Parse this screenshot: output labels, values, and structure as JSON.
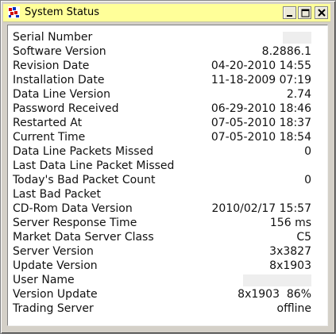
{
  "window": {
    "title": "System Status",
    "minimize_label": "_",
    "maximize_label": "□",
    "close_label": "X"
  },
  "rows": [
    {
      "label": "Serial Number",
      "value": ""
    },
    {
      "label": "Software Version",
      "value": "8.2886.1"
    },
    {
      "label": "Revision Date",
      "value": "04-20-2010 14:55"
    },
    {
      "label": "Installation Date",
      "value": "11-18-2009 07:19"
    },
    {
      "label": "Data Line Version",
      "value": "2.74"
    },
    {
      "label": "Password Received",
      "value": "06-29-2010 18:46"
    },
    {
      "label": "Restarted At",
      "value": "07-05-2010 18:37"
    },
    {
      "label": "Current Time",
      "value": "07-05-2010 18:54"
    },
    {
      "label": "Data Line Packets Missed",
      "value": "0"
    },
    {
      "label": "Last Data Line Packet Missed",
      "value": ""
    },
    {
      "label": "Today's Bad Packet Count",
      "value": "0"
    },
    {
      "label": "Last Bad Packet",
      "value": ""
    },
    {
      "label": "CD-Rom Data Version",
      "value": "2010/02/17 15:57"
    },
    {
      "label": "Server Response Time",
      "value": "156 ms"
    },
    {
      "label": "Market Data Server Class",
      "value": "C5"
    },
    {
      "label": "Server Version",
      "value": "3x3827"
    },
    {
      "label": "Update Version",
      "value": "8x1903"
    },
    {
      "label": "User Name",
      "value": ""
    },
    {
      "label": "Version Update",
      "value": "8x1903  86%"
    },
    {
      "label": "Trading Server",
      "value": "offline"
    }
  ]
}
